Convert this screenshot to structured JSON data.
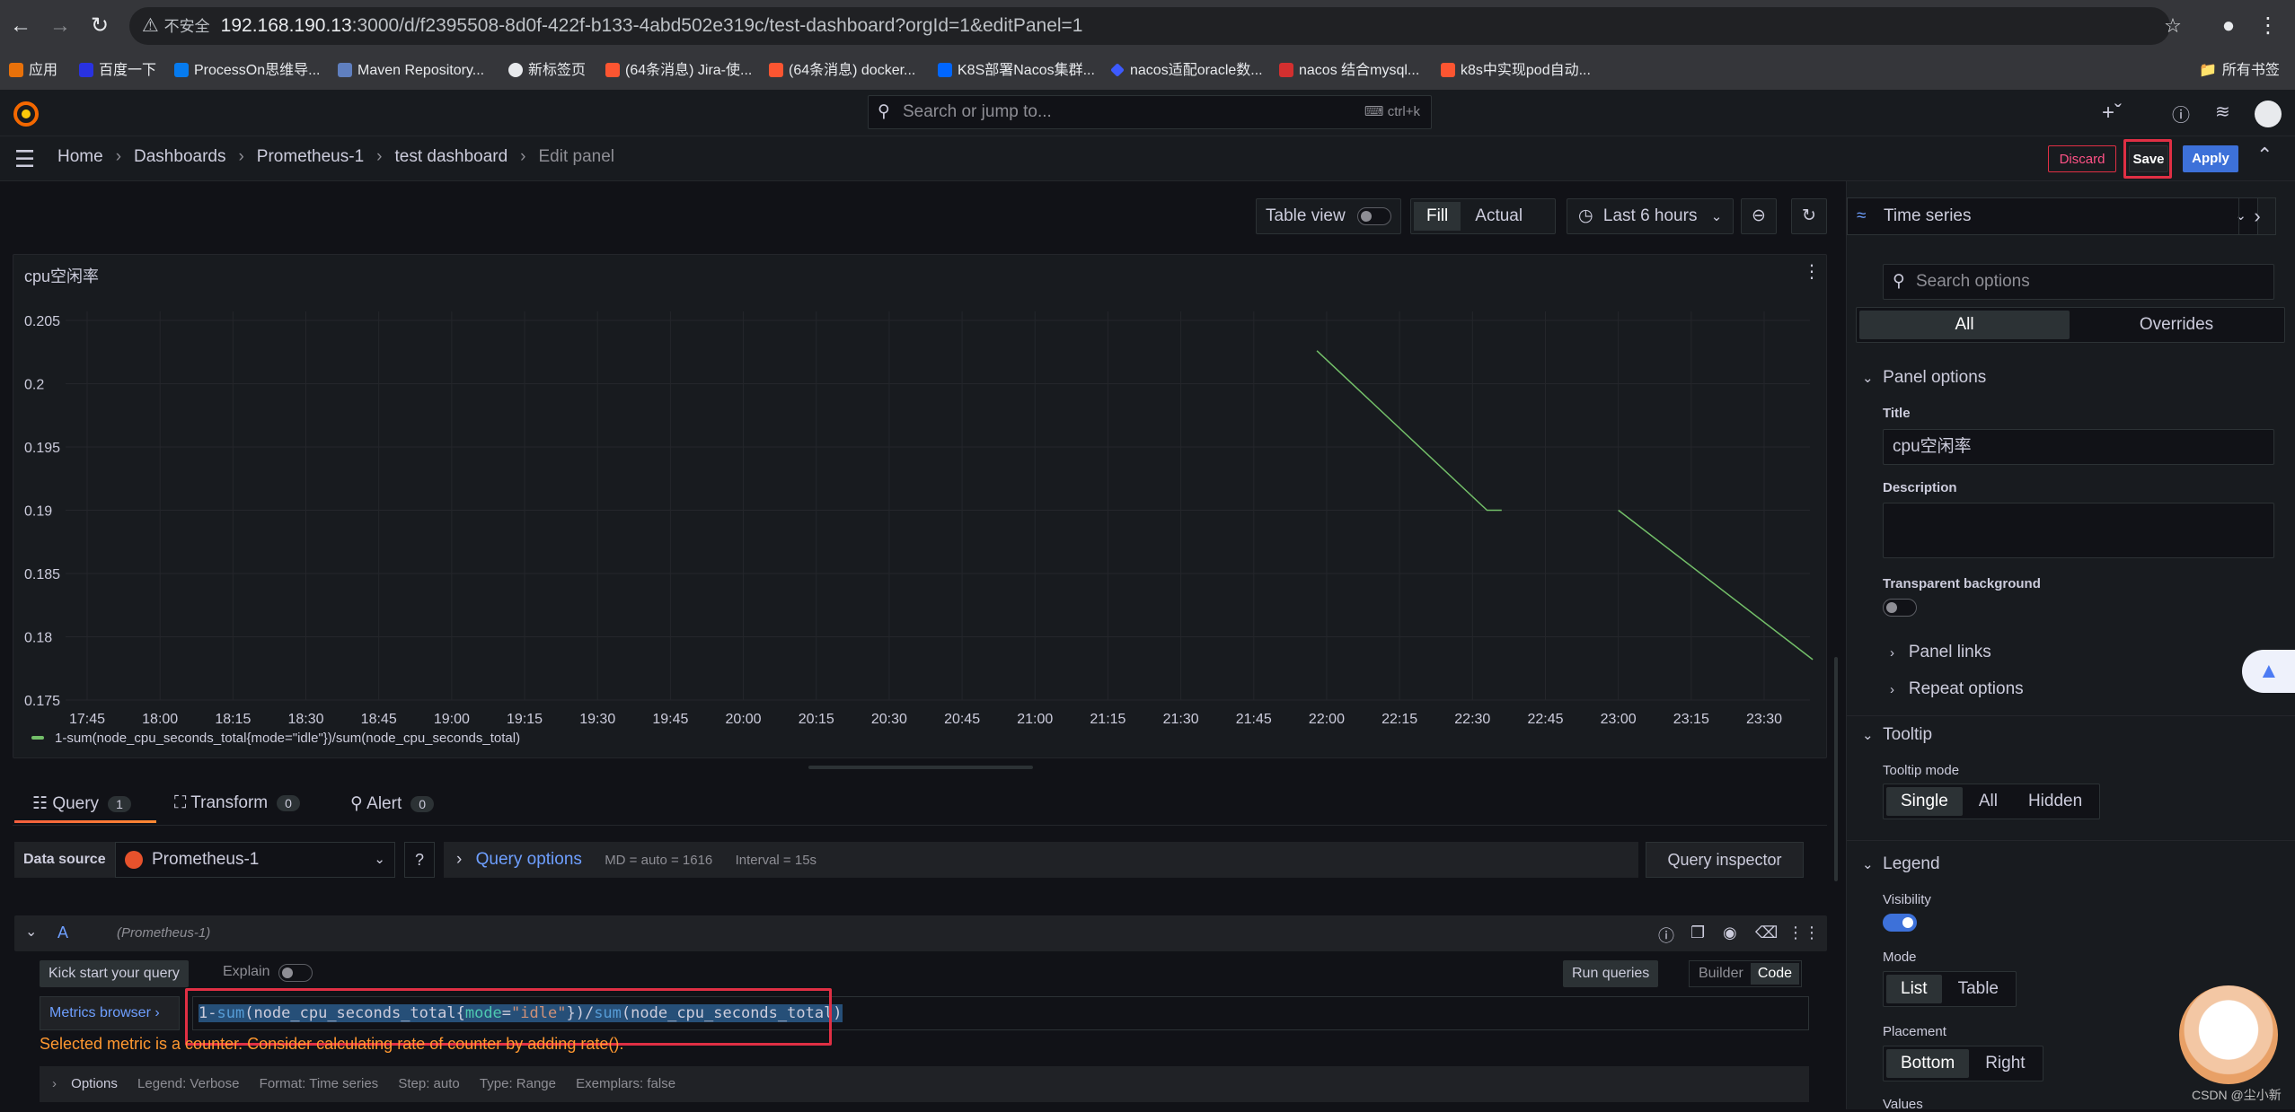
{
  "browser": {
    "security": "不安全",
    "url_host": "192.168.190.13",
    "url_rest": ":3000/d/f2395508-8d0f-422f-b133-4abd502e319c/test-dashboard?orgId=1&editPanel=1",
    "bookmarks": [
      "应用",
      "百度一下",
      "ProcessOn思维导...",
      "Maven Repository...",
      "新标签页",
      "(64条消息) Jira-使...",
      "(64条消息) docker...",
      "K8S部署Nacos集群...",
      "nacos适配oracle数...",
      "nacos 结合mysql...",
      "k8s中实现pod自动..."
    ],
    "all_bookmarks": "所有书签"
  },
  "topnav": {
    "search_placeholder": "Search or jump to...",
    "shortcut": "ctrl+k"
  },
  "breadcrumb": {
    "home": "Home",
    "dashboards": "Dashboards",
    "datasource": "Prometheus-1",
    "dashboard": "test dashboard",
    "current": "Edit panel"
  },
  "actions": {
    "discard": "Discard",
    "save": "Save",
    "apply": "Apply"
  },
  "toolbar": {
    "table_view": "Table view",
    "fill": "Fill",
    "actual": "Actual",
    "time_range": "Last 6 hours"
  },
  "panel": {
    "title": "cpu空闲率",
    "legend": "1-sum(node_cpu_seconds_total{mode=\"idle\"})/sum(node_cpu_seconds_total)"
  },
  "chart_data": {
    "type": "line",
    "title": "cpu空闲率",
    "ylim": [
      0.175,
      0.205
    ],
    "yticks": [
      "0.205",
      "0.2",
      "0.195",
      "0.19",
      "0.185",
      "0.18",
      "0.175"
    ],
    "xticks": [
      "17:45",
      "18:00",
      "18:15",
      "18:30",
      "18:45",
      "19:00",
      "19:15",
      "19:30",
      "19:45",
      "20:00",
      "20:15",
      "20:30",
      "20:45",
      "21:00",
      "21:15",
      "21:30",
      "21:45",
      "22:00",
      "22:15",
      "22:30",
      "22:45",
      "23:00",
      "23:15",
      "23:30"
    ],
    "series": [
      {
        "name": "1-sum(node_cpu_seconds_total{mode=\"idle\"})/sum(node_cpu_seconds_total)",
        "segments": [
          [
            [
              "21:58",
              0.2026
            ],
            [
              "22:33",
              0.19
            ],
            [
              "22:36",
              0.19
            ]
          ],
          [
            [
              "23:00",
              0.19
            ],
            [
              "23:40",
              0.1782
            ]
          ]
        ]
      }
    ],
    "color": "#73bf69",
    "legend": "bottom-left"
  },
  "query_tabs": [
    {
      "label": "Query",
      "count": "1"
    },
    {
      "label": "Transform",
      "count": "0"
    },
    {
      "label": "Alert",
      "count": "0"
    }
  ],
  "datasource": {
    "label": "Data source",
    "value": "Prometheus-1",
    "query_options": "Query options",
    "md": "MD = auto = 1616",
    "interval": "Interval = 15s",
    "inspector": "Query inspector"
  },
  "query": {
    "ref": "A",
    "ds": "(Prometheus-1)",
    "kick": "Kick start your query",
    "explain": "Explain",
    "run": "Run queries",
    "builder": "Builder",
    "code": "Code",
    "metrics_browser": "Metrics browser",
    "expr_1": "1-",
    "expr_sum": "sum",
    "expr_2": "(node_cpu_seconds_total{",
    "expr_mode": "mode",
    "expr_eq": "=",
    "expr_idle": "\"idle\"",
    "expr_3": "})/",
    "expr_sum2": "sum",
    "expr_4": "(node_cpu_seconds_total)",
    "warning": "Selected metric is a counter. Consider calculating rate of counter by adding rate().",
    "options": "Options",
    "opt_legend": "Legend: Verbose",
    "opt_format": "Format: Time series",
    "opt_step": "Step: auto",
    "opt_type": "Type: Range",
    "opt_exemplars": "Exemplars: false"
  },
  "options_pane": {
    "viz": "Time series",
    "search_placeholder": "Search options",
    "all": "All",
    "overrides": "Overrides",
    "panel_options": "Panel options",
    "title_label": "Title",
    "title_value": "cpu空闲率",
    "description": "Description",
    "transparent": "Transparent background",
    "panel_links": "Panel links",
    "repeat_options": "Repeat options",
    "tooltip": "Tooltip",
    "tooltip_mode": "Tooltip mode",
    "tt_single": "Single",
    "tt_all": "All",
    "tt_hidden": "Hidden",
    "legend": "Legend",
    "visibility": "Visibility",
    "mode": "Mode",
    "mode_list": "List",
    "mode_table": "Table",
    "placement": "Placement",
    "pl_bottom": "Bottom",
    "pl_right": "Right",
    "values": "Values"
  },
  "watermark": "CSDN @尘小新"
}
